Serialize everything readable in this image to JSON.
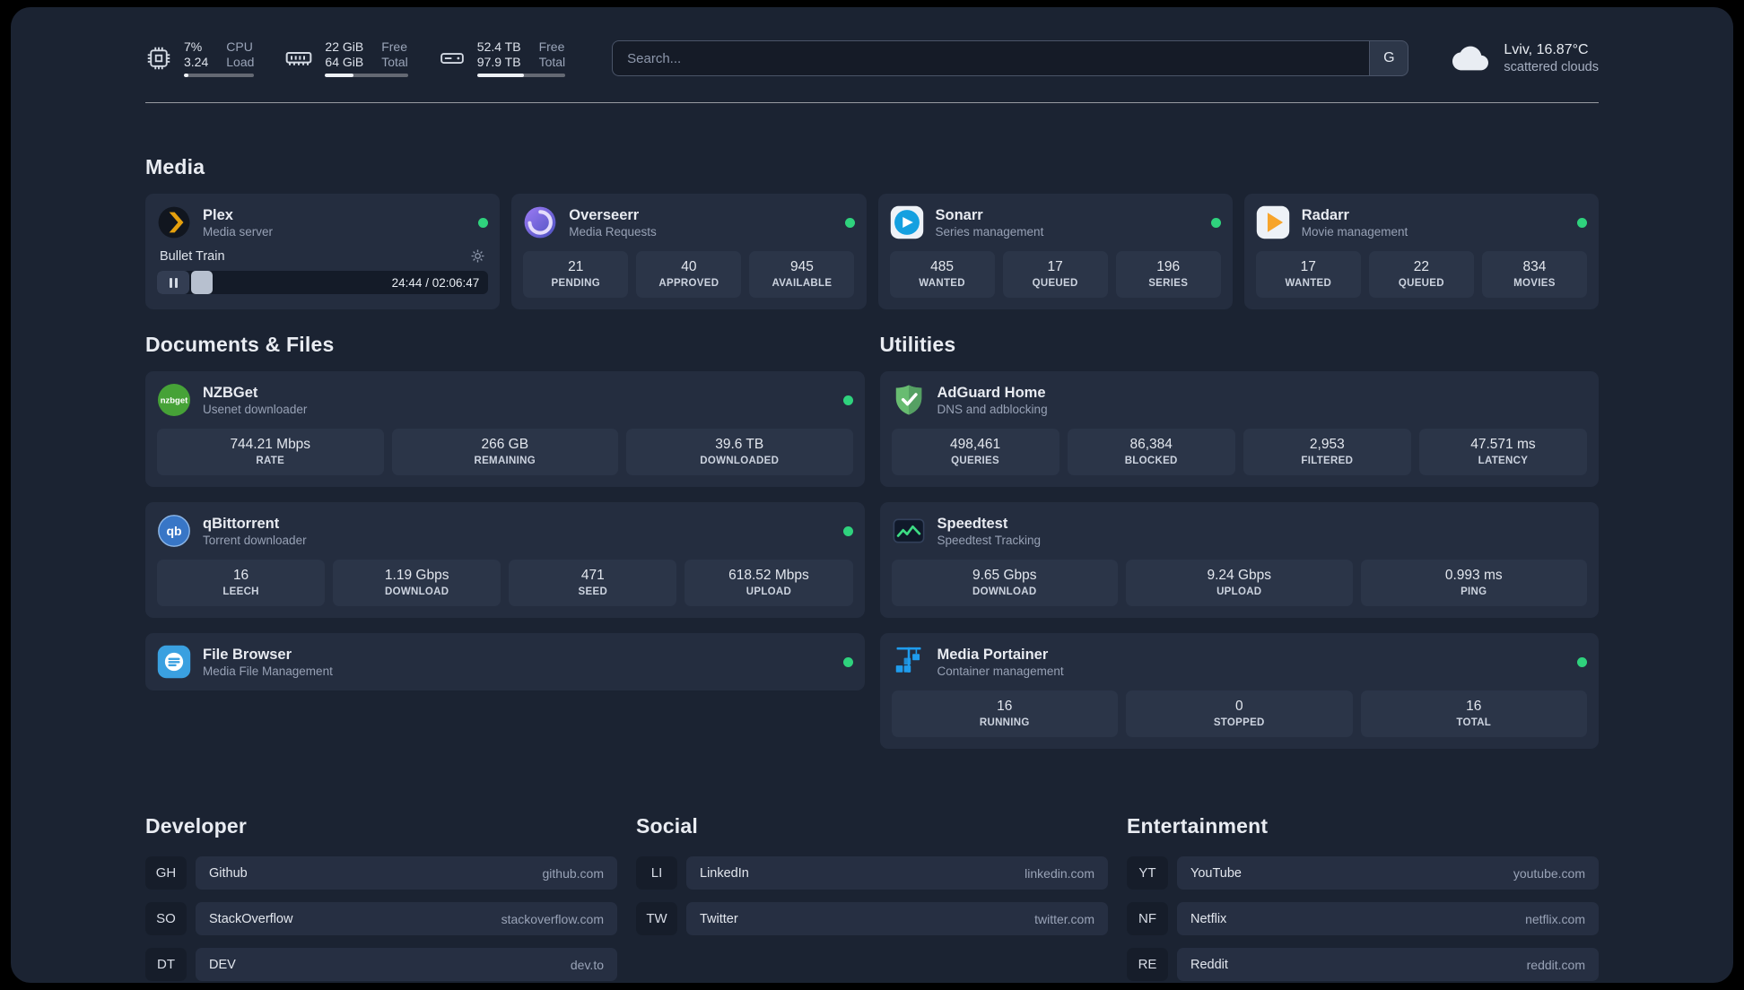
{
  "topbar": {
    "cpu": {
      "value1": "7%",
      "value2": "3.24",
      "label1": "CPU",
      "label2": "Load"
    },
    "memory": {
      "value1": "22 GiB",
      "value2": "64 GiB",
      "label1": "Free",
      "label2": "Total"
    },
    "disk": {
      "value1": "52.4 TB",
      "value2": "97.9 TB",
      "label1": "Free",
      "label2": "Total"
    },
    "search": {
      "placeholder": "Search...",
      "provider": "G"
    },
    "weather": {
      "location": "Lviv, 16.87°C",
      "condition": "scattered clouds"
    }
  },
  "media": {
    "title": "Media",
    "plex": {
      "name": "Plex",
      "subtitle": "Media server",
      "now_playing": "Bullet Train",
      "time": "24:44 / 02:06:47"
    },
    "overseerr": {
      "name": "Overseerr",
      "subtitle": "Media Requests",
      "stats": [
        {
          "value": "21",
          "label": "PENDING"
        },
        {
          "value": "40",
          "label": "APPROVED"
        },
        {
          "value": "945",
          "label": "AVAILABLE"
        }
      ]
    },
    "sonarr": {
      "name": "Sonarr",
      "subtitle": "Series management",
      "stats": [
        {
          "value": "485",
          "label": "WANTED"
        },
        {
          "value": "17",
          "label": "QUEUED"
        },
        {
          "value": "196",
          "label": "SERIES"
        }
      ]
    },
    "radarr": {
      "name": "Radarr",
      "subtitle": "Movie management",
      "stats": [
        {
          "value": "17",
          "label": "WANTED"
        },
        {
          "value": "22",
          "label": "QUEUED"
        },
        {
          "value": "834",
          "label": "MOVIES"
        }
      ]
    }
  },
  "documents": {
    "title": "Documents & Files",
    "nzbget": {
      "name": "NZBGet",
      "subtitle": "Usenet downloader",
      "stats": [
        {
          "value": "744.21 Mbps",
          "label": "RATE"
        },
        {
          "value": "266 GB",
          "label": "REMAINING"
        },
        {
          "value": "39.6 TB",
          "label": "DOWNLOADED"
        }
      ]
    },
    "qbittorrent": {
      "name": "qBittorrent",
      "subtitle": "Torrent downloader",
      "stats": [
        {
          "value": "16",
          "label": "LEECH"
        },
        {
          "value": "1.19 Gbps",
          "label": "DOWNLOAD"
        },
        {
          "value": "471",
          "label": "SEED"
        },
        {
          "value": "618.52 Mbps",
          "label": "UPLOAD"
        }
      ]
    },
    "filebrowser": {
      "name": "File Browser",
      "subtitle": "Media File Management"
    }
  },
  "utilities": {
    "title": "Utilities",
    "adguard": {
      "name": "AdGuard Home",
      "subtitle": "DNS and adblocking",
      "stats": [
        {
          "value": "498,461",
          "label": "QUERIES"
        },
        {
          "value": "86,384",
          "label": "BLOCKED"
        },
        {
          "value": "2,953",
          "label": "FILTERED"
        },
        {
          "value": "47.571 ms",
          "label": "LATENCY"
        }
      ]
    },
    "speedtest": {
      "name": "Speedtest",
      "subtitle": "Speedtest Tracking",
      "stats": [
        {
          "value": "9.65 Gbps",
          "label": "DOWNLOAD"
        },
        {
          "value": "9.24 Gbps",
          "label": "UPLOAD"
        },
        {
          "value": "0.993 ms",
          "label": "PING"
        }
      ]
    },
    "portainer": {
      "name": "Media Portainer",
      "subtitle": "Container management",
      "stats": [
        {
          "value": "16",
          "label": "RUNNING"
        },
        {
          "value": "0",
          "label": "STOPPED"
        },
        {
          "value": "16",
          "label": "TOTAL"
        }
      ]
    }
  },
  "bookmarks": {
    "developer": {
      "title": "Developer",
      "items": [
        {
          "abbr": "GH",
          "name": "Github",
          "domain": "github.com"
        },
        {
          "abbr": "SO",
          "name": "StackOverflow",
          "domain": "stackoverflow.com"
        },
        {
          "abbr": "DT",
          "name": "DEV",
          "domain": "dev.to"
        }
      ]
    },
    "social": {
      "title": "Social",
      "items": [
        {
          "abbr": "LI",
          "name": "LinkedIn",
          "domain": "linkedin.com"
        },
        {
          "abbr": "TW",
          "name": "Twitter",
          "domain": "twitter.com"
        }
      ]
    },
    "entertainment": {
      "title": "Entertainment",
      "items": [
        {
          "abbr": "YT",
          "name": "YouTube",
          "domain": "youtube.com"
        },
        {
          "abbr": "NF",
          "name": "Netflix",
          "domain": "netflix.com"
        },
        {
          "abbr": "RE",
          "name": "Reddit",
          "domain": "reddit.com"
        }
      ]
    }
  }
}
